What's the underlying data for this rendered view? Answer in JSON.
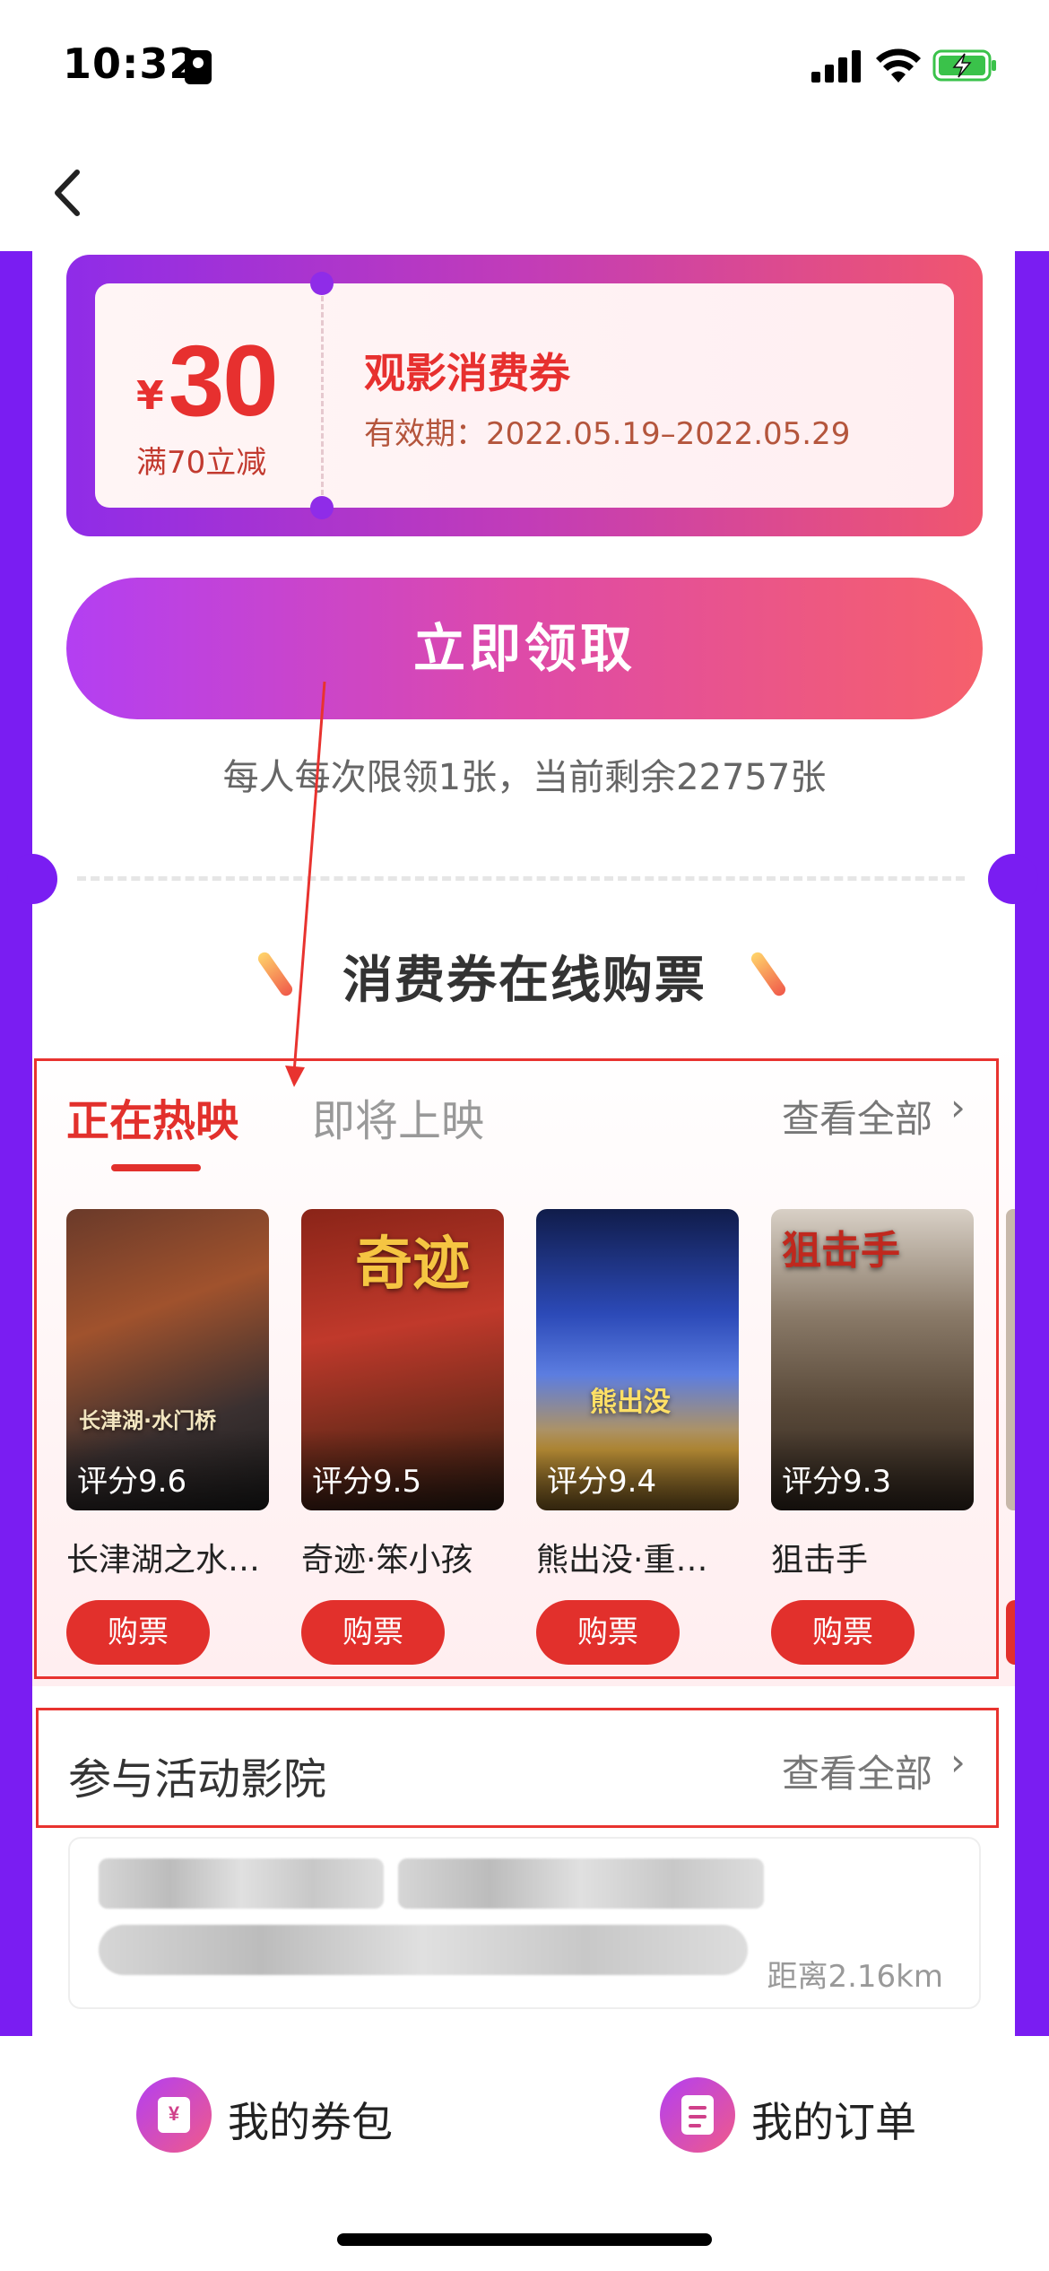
{
  "status_bar": {
    "time": "10:32"
  },
  "coupon": {
    "currency": "¥",
    "amount": "30",
    "condition": "满70立减",
    "title": "观影消费券",
    "validity": "有效期：2022.05.19–2022.05.29"
  },
  "claim": {
    "button_label": "立即领取",
    "note": "每人每次限领1张，当前剩余22757张"
  },
  "section": {
    "heading": "消费券在线购票"
  },
  "tabs": {
    "items": [
      {
        "label": "正在热映",
        "active": true
      },
      {
        "label": "即将上映",
        "active": false
      }
    ],
    "view_all": "查看全部",
    "chevron": "›"
  },
  "movies": [
    {
      "title": "长津湖之水…",
      "score": "评分9.6",
      "buy": "购票",
      "poster_art": "长津湖·水门桥",
      "colors": [
        "#4a2c22",
        "#8a4a2a",
        "#2c2c2c"
      ]
    },
    {
      "title": "奇迹·笨小孩",
      "score": "评分9.5",
      "buy": "购票",
      "poster_art": "奇迹",
      "colors": [
        "#7a1e14",
        "#b53020",
        "#3a1a10"
      ]
    },
    {
      "title": "熊出没·重…",
      "score": "评分9.4",
      "buy": "购票",
      "poster_art": "熊出没",
      "colors": [
        "#1a2a6a",
        "#3b5fd0",
        "#caa040"
      ]
    },
    {
      "title": "狙击手",
      "score": "评分9.3",
      "buy": "购票",
      "poster_art": "狙击手",
      "colors": [
        "#5a4a3a",
        "#8a7a6a",
        "#3a2e26"
      ]
    }
  ],
  "cinemas": {
    "heading": "参与活动影院",
    "view_all": "查看全部",
    "chevron": "›",
    "items": [
      {
        "distance": "距离2.16km"
      }
    ]
  },
  "bottom_nav": {
    "coupons_label": "我的券包",
    "orders_label": "我的订单"
  },
  "colors": {
    "purple": "#7a1df2",
    "red": "#e2302c",
    "coupon_red": "#e7302f"
  }
}
